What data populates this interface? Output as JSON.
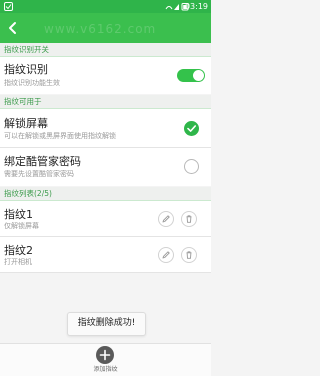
{
  "status_bar": {
    "time": "03:19"
  },
  "toolbar": {
    "watermark": "www.v6162.com"
  },
  "sections": {
    "switch": {
      "title": "指纹识别开关"
    },
    "usage": {
      "title": "指纹可用于"
    },
    "list": {
      "title": "指纹列表(2/5)"
    }
  },
  "fingerprint_recognition": {
    "title": "指纹识别",
    "subtitle": "指纹识别功能生效",
    "enabled": true
  },
  "unlock_screen": {
    "title": "解锁屏幕",
    "subtitle": "可以在解锁或黑屏界面使用指纹解锁",
    "checked": true
  },
  "bind_password": {
    "title": "绑定酷管家密码",
    "subtitle": "需要先设置酷管家密码",
    "checked": false
  },
  "fingerprints": [
    {
      "name": "指纹1",
      "action": "仅解锁屏幕"
    },
    {
      "name": "指纹2",
      "action": "打开相机"
    }
  ],
  "toast": {
    "message": "指纹删除成功!"
  },
  "bottom_bar": {
    "add_label": "添加指纹"
  },
  "colors": {
    "accent": "#3bbf4e",
    "status_bar": "#2fb44a",
    "section_text": "#3a9a4a"
  }
}
